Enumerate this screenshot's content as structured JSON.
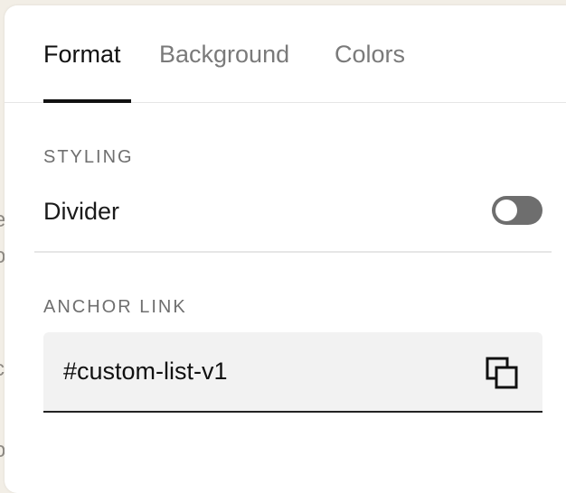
{
  "tabs": [
    {
      "label": "Format",
      "active": true
    },
    {
      "label": "Background",
      "active": false
    },
    {
      "label": "Colors",
      "active": false
    }
  ],
  "styling": {
    "section_label": "STYLING",
    "divider_label": "Divider",
    "divider_toggle_on": false
  },
  "anchor": {
    "section_label": "ANCHOR LINK",
    "value": "#custom-list-v1",
    "copy_icon": "copy-icon"
  },
  "colors": {
    "page_background": "#f2eee6",
    "panel_background": "#ffffff",
    "active_text": "#111111",
    "inactive_text": "#7a7a7a",
    "toggle_off": "#6e6e6e",
    "field_background": "#f2f2f2"
  }
}
